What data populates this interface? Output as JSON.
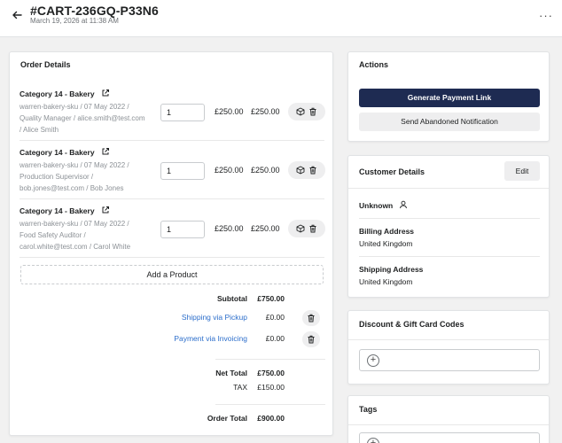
{
  "header": {
    "cart_id": "#CART-236GQ-P33N6",
    "date": "March 19, 2026 at 11:38 AM",
    "more": "···"
  },
  "order": {
    "title": "Order Details",
    "items": [
      {
        "title": "Category 14 - Bakery",
        "meta1": "warren-bakery-sku / 07 May 2022 /",
        "meta2": "Quality Manager / alice.smith@test.com",
        "meta3": "/ Alice Smith",
        "qty": "1",
        "unit_price": "£250.00",
        "total": "£250.00"
      },
      {
        "title": "Category 14 - Bakery",
        "meta1": "warren-bakery-sku / 07 May 2022 /",
        "meta2": "Production Supervisor /",
        "meta3": "bob.jones@test.com / Bob Jones",
        "qty": "1",
        "unit_price": "£250.00",
        "total": "£250.00"
      },
      {
        "title": "Category 14 - Bakery",
        "meta1": "warren-bakery-sku / 07 May 2022 /",
        "meta2": "Food Safety Auditor /",
        "meta3": "carol.white@test.com / Carol White",
        "qty": "1",
        "unit_price": "£250.00",
        "total": "£250.00"
      }
    ],
    "add_product": "Add a Product",
    "subtotal_label": "Subtotal",
    "subtotal": "£750.00",
    "shipping_label": "Shipping via Pickup",
    "shipping": "£0.00",
    "payment_label": "Payment via Invoicing",
    "payment": "£0.00",
    "net_total_label": "Net Total",
    "net_total": "£750.00",
    "tax_label": "TAX",
    "tax": "£150.00",
    "order_total_label": "Order Total",
    "order_total": "£900.00"
  },
  "actions": {
    "title": "Actions",
    "primary": "Generate Payment Link",
    "secondary": "Send Abandoned Notification"
  },
  "customer": {
    "title": "Customer Details",
    "edit": "Edit",
    "name": "Unknown",
    "billing_label": "Billing Address",
    "billing": "United Kingdom",
    "shipping_label": "Shipping Address",
    "shipping": "United Kingdom"
  },
  "discount": {
    "title": "Discount & Gift Card Codes"
  },
  "tags": {
    "title": "Tags"
  },
  "colors": {
    "primary_button": "#1e2b52",
    "link": "#2c6ecb",
    "background": "#f1f1f1"
  }
}
